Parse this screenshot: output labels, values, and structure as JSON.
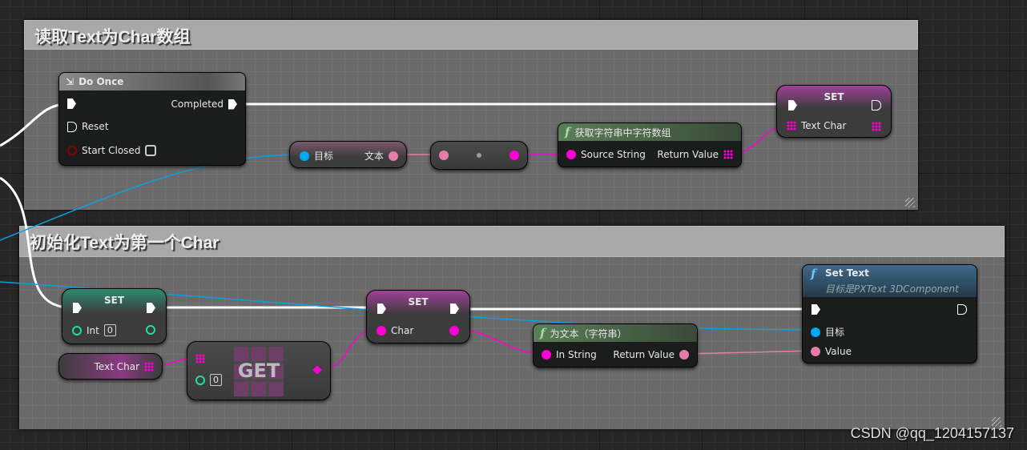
{
  "comments": [
    {
      "title": "读取Text为Char数组"
    },
    {
      "title": "初始化Text为第一个Char"
    }
  ],
  "nodes": {
    "do_once": {
      "title": "Do Once",
      "completed": "Completed",
      "reset": "Reset",
      "start_closed": "Start Closed"
    },
    "get_text": {
      "target": "目标",
      "text": "文本"
    },
    "get_char_array": {
      "title": "获取字符串中字符数组",
      "source": "Source String",
      "ret": "Return Value"
    },
    "set_text_char": {
      "title": "SET",
      "var": "Text Char"
    },
    "set_int": {
      "title": "SET",
      "var": "Int",
      "value": "0"
    },
    "text_char_getter": {
      "var": "Text Char"
    },
    "get_array": {
      "title": "GET",
      "index": "0"
    },
    "set_char": {
      "title": "SET",
      "var": "Char"
    },
    "to_text": {
      "title": "为文本（字符串）",
      "in": "In String",
      "ret": "Return Value"
    },
    "set_text": {
      "title": "Set Text",
      "subtitle": "目标是PXText 3DComponent",
      "target": "目标",
      "value": "Value"
    }
  },
  "colors": {
    "exec": "#ffffff",
    "object": "#00a8f0",
    "text": "#e67ca8",
    "string": "#ff00d4",
    "int": "#1fe0a0",
    "bool": "#8b0000"
  },
  "watermark": "CSDN @qq_1204157137"
}
